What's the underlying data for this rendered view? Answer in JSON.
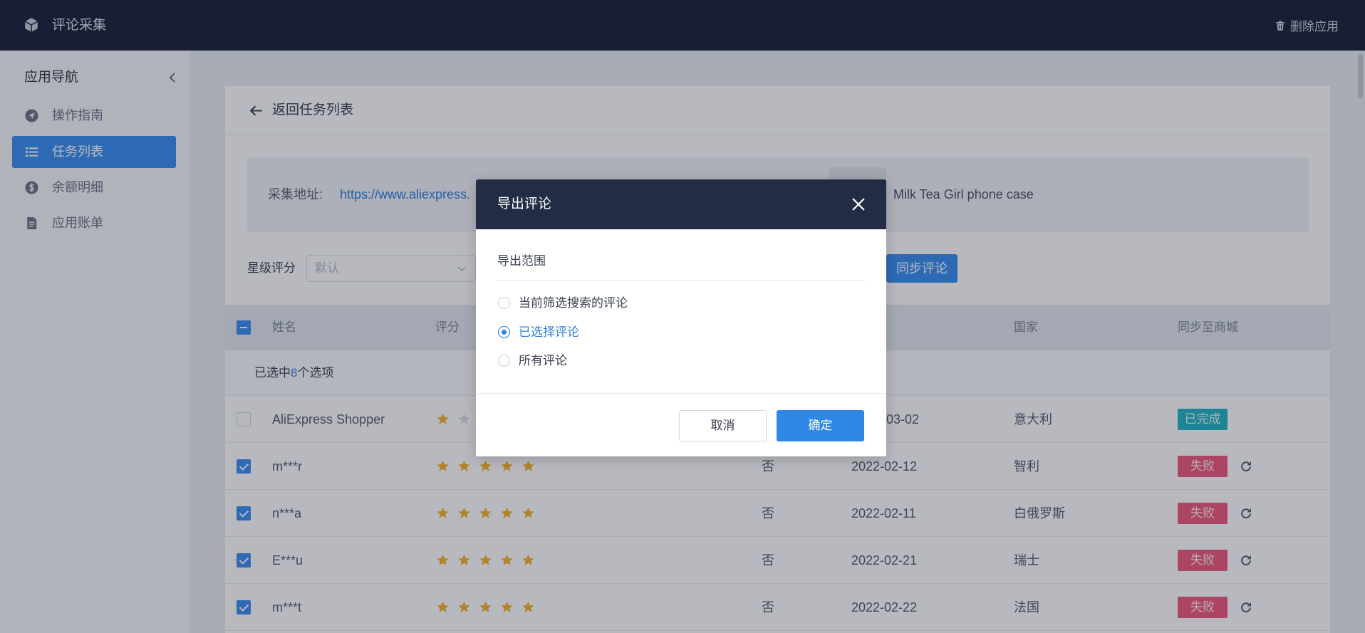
{
  "colors": {
    "topbar": "#1c2339",
    "accent": "#3b8ff0",
    "modal_header": "#222c45",
    "confirm": "#2f88e6",
    "done": "#22b3c2",
    "fail": "#f05a7b",
    "star": "#f7b32b",
    "link": "#2d7fe0"
  },
  "app": {
    "title": "评论采集",
    "logo_icon": "cube-icon",
    "delete_label": "删除应用",
    "delete_icon": "trash-icon"
  },
  "sidebar": {
    "title": "应用导航",
    "collapse_icon": "chevron-left-icon",
    "items": [
      {
        "label": "操作指南",
        "icon": "navigation-icon",
        "active": false
      },
      {
        "label": "任务列表",
        "icon": "list-icon",
        "active": true
      },
      {
        "label": "余额明细",
        "icon": "dollar-icon",
        "active": false
      },
      {
        "label": "应用账单",
        "icon": "bill-icon",
        "active": false
      }
    ]
  },
  "page": {
    "back_icon": "arrow-left-icon",
    "back_label": "返回任务列表"
  },
  "info": {
    "url_label": "采集地址:",
    "url": "https://www.aliexpress.",
    "product_title": "Milk Tea Girl phone case"
  },
  "filters": {
    "rating_label": "星级评分",
    "rating_placeholder": "默认",
    "sync_button": "同步评论"
  },
  "table": {
    "header_checkbox": "indeterminate",
    "columns": {
      "name": "姓名",
      "rating": "评分",
      "country": "国家",
      "sync": "同步至商城"
    },
    "selection": {
      "prefix": "已选中",
      "count": "8",
      "suffix": "个选项"
    },
    "rows": [
      {
        "checked": false,
        "name": "AliExpress Shopper",
        "rating": 1,
        "flag": "",
        "date": "03-02",
        "country": "意大利",
        "status": "已完成",
        "status_type": "done",
        "action_icon": ""
      },
      {
        "checked": true,
        "name": "m***r",
        "rating": 5,
        "flag": "否",
        "date": "2022-02-12",
        "country": "智利",
        "status": "失败",
        "status_type": "fail",
        "action_icon": "refresh-icon"
      },
      {
        "checked": true,
        "name": "n***a",
        "rating": 5,
        "flag": "否",
        "date": "2022-02-11",
        "country": "白俄罗斯",
        "status": "失败",
        "status_type": "fail",
        "action_icon": "refresh-icon"
      },
      {
        "checked": true,
        "name": "E***u",
        "rating": 5,
        "flag": "否",
        "date": "2022-02-21",
        "country": "瑞士",
        "status": "失败",
        "status_type": "fail",
        "action_icon": "refresh-icon"
      },
      {
        "checked": true,
        "name": "m***t",
        "rating": 5,
        "flag": "否",
        "date": "2022-02-22",
        "country": "法国",
        "status": "失败",
        "status_type": "fail",
        "action_icon": "refresh-icon"
      }
    ]
  },
  "modal": {
    "title": "导出评论",
    "close_icon": "close-icon",
    "section_label": "导出范围",
    "options": [
      "当前筛选搜索的评论",
      "已选择评论",
      "所有评论"
    ],
    "selected": 1,
    "cancel": "取消",
    "confirm": "确定"
  }
}
